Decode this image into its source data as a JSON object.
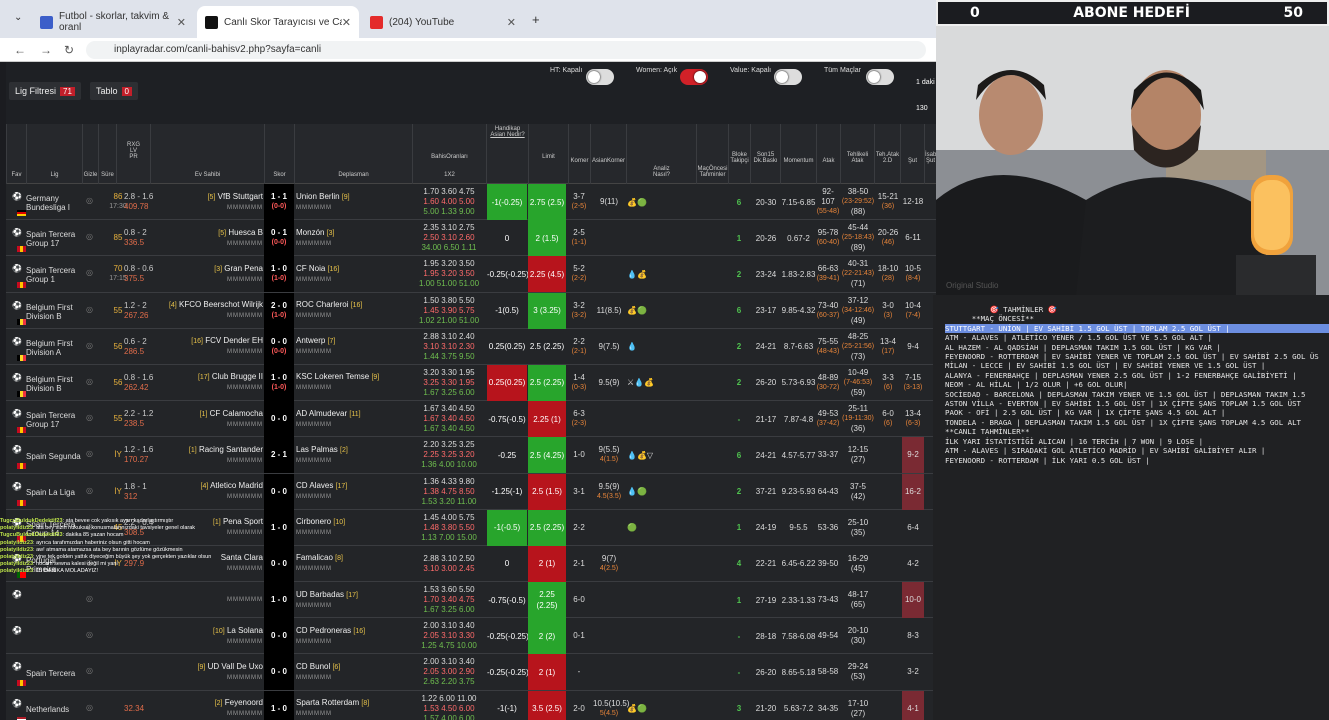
{
  "browser": {
    "tabs": [
      {
        "label": "Futbol - skorlar, takvim & oranl",
        "icon": "flashscore-icon"
      },
      {
        "label": "Canlı Skor Tarayıcısı ve Canlı Sk",
        "icon": "inplayradar-icon"
      },
      {
        "label": "(204) YouTube",
        "icon": "youtube-icon"
      }
    ],
    "url": "inplayradar.com/canli-bahisv2.php?sayfa=canli"
  },
  "filters": {
    "lig": "Lig Filtresi",
    "lig_count": "71",
    "tablo": "Tablo",
    "tablo_count": "0",
    "ht": "HT: Kapalı",
    "women": "Women: Açık",
    "value": "Value: Kapalı",
    "tum": "Tüm Maçlar",
    "side": "1 daki",
    "side2": "130 dak"
  },
  "headers": {
    "fav": "Fav",
    "lig": "Lig",
    "gizle": "Gizle",
    "sure": "Süre",
    "rxg": "RXG",
    "lv": "LV",
    "pr": "PR",
    "ev": "Ev Sahibi",
    "skor": "Skor",
    "dep": "Deplasman",
    "bo": "BahisOranları",
    "x2": "1X2",
    "hcp": "Handikap",
    "asian": "Asian Nedir?",
    "limit": "Limit",
    "korner": "Korner",
    "asian_korner": "AsianKorner",
    "analiz": "Analiz",
    "nasil": "Nasıl?",
    "maconcesi": "MaçÖncesi Tahminler",
    "bloke": "Bloke Takipçi",
    "son15": "Son15 Dk.Baskı",
    "momentum": "Momentum",
    "atak": "Atak",
    "tehlikeli": "Tehlikeli Atak",
    "tehatak": "Teh.Atak 2.D",
    "sut": "Şut",
    "isabet": "İsabet Şut"
  },
  "rows": [
    {
      "lig": "Germany Bundesliga I",
      "flag": "de",
      "min": "86",
      "time": "17:30",
      "rxg": "2.8 - 1.6",
      "r": "409.78",
      "home": "VfB Stuttgart",
      "hr": "[5]",
      "score": "1 - 1",
      "ht": "(0-0)",
      "away": "Union Berlin",
      "ar": "[9]",
      "o1": "1.70  3.60  4.75",
      "o2": "1.60  4.00  5.00",
      "o3": "5.00  1.33  9.00",
      "hcp": "-1(-0.25)",
      "hc": "g",
      "lim": "2.75 (2.5)",
      "lc": "g",
      "kor": "3-7",
      "ks": "(2-5)",
      "ak": "9(11)",
      "aks": "",
      "an": "💰🟢",
      "bk": "6",
      "sn": "20-30",
      "mo": "7.15-6.85",
      "at": "92-107",
      "ats": "(55-48)",
      "te": "38-50",
      "tes": "(23-29:52)",
      "te3": "(88)",
      "ta": "15-21",
      "tas": "(36)",
      "su": "12-18",
      "sus": "",
      "shl": false
    },
    {
      "lig": "Spain Tercera Group 17",
      "flag": "es",
      "min": "85",
      "time": "",
      "rxg": "0.8 - 2",
      "r": "336.5",
      "home": "Huesca B",
      "hr": "[5]",
      "score": "0 - 1",
      "ht": "(0-0)",
      "away": "Monzón",
      "ar": "[3]",
      "o1": "2.35  3.10  2.75",
      "o2": "2.50  3.10  2.60",
      "o3": "34.00  6.50  1.11",
      "hcp": "0",
      "hc": "d",
      "lim": "2 (1.5)",
      "lc": "g",
      "kor": "2-5",
      "ks": "(1-1)",
      "ak": "",
      "aks": "",
      "an": "",
      "bk": "1",
      "sn": "20-26",
      "mo": "0.67-2",
      "at": "95-78",
      "ats": "(60-40)",
      "te": "45-44",
      "tes": "(25-18:43)",
      "te3": "(89)",
      "ta": "20-26",
      "tas": "(46)",
      "su": "6-11",
      "sus": "",
      "shl": false
    },
    {
      "lig": "Spain Tercera Group 1",
      "flag": "es",
      "min": "70",
      "time": "17:15",
      "rxg": "0.8 - 0.6",
      "r": "375.5",
      "home": "Gran Pena",
      "hr": "[3]",
      "score": "1 - 0",
      "ht": "(1-0)",
      "away": "CF Noia",
      "ar": "[16]",
      "o1": "1.95  3.20  3.50",
      "o2": "1.95  3.20  3.50",
      "o3": "1.00  51.00  51.00",
      "hcp": "-0.25(-0.25)",
      "hc": "d",
      "lim": "2.25 (4.5)",
      "lc": "r",
      "kor": "5-2",
      "ks": "(2-2)",
      "ak": "",
      "aks": "",
      "an": "💧💰",
      "bk": "2",
      "sn": "23-24",
      "mo": "1.83-2.83",
      "at": "66-63",
      "ats": "(39-41)",
      "te": "40-31",
      "tes": "(22-21:43)",
      "te3": "(71)",
      "ta": "18-10",
      "tas": "(28)",
      "su": "10-5",
      "sus": "(8-4)",
      "shl": false
    },
    {
      "lig": "Belgium First Division B",
      "flag": "be",
      "min": "55",
      "time": "",
      "rxg": "1.2 - 2",
      "r": "267.26",
      "home": "KFCO Beerschot Wilrijk",
      "hr": "[4]",
      "score": "2 - 0",
      "ht": "(1-0)",
      "away": "ROC Charleroi",
      "ar": "[16]",
      "o1": "1.50  3.80  5.50",
      "o2": "1.45  3.90  5.75",
      "o3": "1.02  21.00  51.00",
      "hcp": "-1(0.5)",
      "hc": "d",
      "lim": "3 (3.25)",
      "lc": "g",
      "kor": "3-2",
      "ks": "(3-2)",
      "ak": "11(8.5)",
      "aks": "",
      "an": "💰🟢",
      "bk": "6",
      "sn": "23-17",
      "mo": "9.85-4.32",
      "at": "73-40",
      "ats": "(60-37)",
      "te": "37-12",
      "tes": "(34-12:46)",
      "te3": "(49)",
      "ta": "3-0",
      "tas": "(3)",
      "su": "10-4",
      "sus": "(7-4)",
      "shl": false
    },
    {
      "lig": "Belgium First Division A",
      "flag": "be",
      "min": "56",
      "time": "",
      "rxg": "0.6 - 2",
      "r": "286.5",
      "home": "FCV Dender EH",
      "hr": "[16]",
      "score": "0 - 0",
      "ht": "(0-0)",
      "away": "Antwerp",
      "ar": "[7]",
      "o1": "2.88  3.10  2.40",
      "o2": "3.10  3.10  2.30",
      "o3": "1.44  3.75  9.50",
      "hcp": "0.25(0.25)",
      "hc": "d",
      "lim": "2.5 (2.25)",
      "lc": "d",
      "kor": "2-2",
      "ks": "(2-1)",
      "ak": "9(7.5)",
      "aks": "",
      "an": "💧",
      "bk": "2",
      "sn": "24-21",
      "mo": "8.7-6.63",
      "at": "75-55",
      "ats": "(48-43)",
      "te": "48-25",
      "tes": "(25-21:56)",
      "te3": "(73)",
      "ta": "13-4",
      "tas": "(17)",
      "su": "9-4",
      "sus": "",
      "shl": false
    },
    {
      "lig": "Belgium First Division B",
      "flag": "be",
      "min": "56",
      "time": "",
      "rxg": "0.8 - 1.6",
      "r": "262.42",
      "home": "Club Brugge II",
      "hr": "[17]",
      "score": "1 - 0",
      "ht": "(1-0)",
      "away": "KSC Lokeren Temse",
      "ar": "[9]",
      "o1": "3.20  3.30  1.95",
      "o2": "3.25  3.30  1.95",
      "o3": "1.67  3.25  6.00",
      "hcp": "0.25(0.25)",
      "hc": "r",
      "lim": "2.5 (2.25)",
      "lc": "g",
      "kor": "1-4",
      "ks": "(0-3)",
      "ak": "9.5(9)",
      "aks": "",
      "an": "⚔💧💰",
      "bk": "2",
      "sn": "26-20",
      "mo": "5.73-6.93",
      "at": "48-89",
      "ats": "(30-72)",
      "te": "10-49",
      "tes": "(7-46:53)",
      "te3": "(59)",
      "ta": "3-3",
      "tas": "(6)",
      "su": "7-15",
      "sus": "(3-13)",
      "shl": false
    },
    {
      "lig": "Spain Tercera Group 17",
      "flag": "es",
      "min": "55",
      "time": "",
      "rxg": "2.2 - 1.2",
      "r": "238.5",
      "home": "CF Calamocha",
      "hr": "[1]",
      "score": "0 - 0",
      "ht": "",
      "away": "AD Almudevar",
      "ar": "[11]",
      "o1": "1.67  3.40  4.50",
      "o2": "1.67  3.40  4.50",
      "o3": "1.67  3.40  4.50",
      "hcp": "-0.75(-0.5)",
      "hc": "d",
      "lim": "2.25 (1)",
      "lc": "r",
      "kor": "6-3",
      "ks": "(2-3)",
      "ak": "",
      "aks": "",
      "an": "",
      "bk": "-",
      "sn": "21-17",
      "mo": "7.87-4.8",
      "at": "49-53",
      "ats": "(37-42)",
      "te": "25-11",
      "tes": "(19-11:30)",
      "te3": "(36)",
      "ta": "6-0",
      "tas": "(6)",
      "su": "13-4",
      "sus": "(6-3)",
      "shl": false
    },
    {
      "lig": "Spain Segunda",
      "flag": "es",
      "min": "İY",
      "time": "",
      "rxg": "1.2 - 1.6",
      "r": "170.27",
      "home": "Racing Santander",
      "hr": "[1]",
      "score": "2 - 1",
      "ht": "",
      "away": "Las Palmas",
      "ar": "[2]",
      "o1": "2.20  3.25  3.25",
      "o2": "2.25  3.25  3.20",
      "o3": "1.36  4.00  10.00",
      "hcp": "-0.25",
      "hc": "d",
      "lim": "2.5 (4.25)",
      "lc": "g",
      "kor": "1-0",
      "ks": "",
      "ak": "9(5.5)",
      "aks": "4(1.5)",
      "an": "💧💰▽",
      "bk": "6",
      "sn": "24-21",
      "mo": "4.57-5.77",
      "at": "33-37",
      "ats": "",
      "te": "12-15",
      "tes": "",
      "te3": "(27)",
      "ta": "",
      "tas": "",
      "su": "9-2",
      "sus": "",
      "shl": true
    },
    {
      "lig": "Spain La Liga",
      "flag": "es",
      "min": "İY",
      "time": "",
      "rxg": "1.8 - 1",
      "r": "312",
      "home": "Atletico Madrid",
      "hr": "[4]",
      "score": "0 - 0",
      "ht": "",
      "away": "CD Alaves",
      "ar": "[17]",
      "o1": "1.36  4.33  9.80",
      "o2": "1.38  4.75  8.50",
      "o3": "1.53  3.20  11.00",
      "hcp": "-1.25(-1)",
      "hc": "d",
      "lim": "2.5 (1.5)",
      "lc": "r",
      "kor": "3-1",
      "ks": "",
      "ak": "9.5(9)",
      "aks": "4.5(3.5)",
      "an": "💧🟢",
      "bk": "2",
      "sn": "37-21",
      "mo": "9.23-5.93",
      "at": "64-43",
      "ats": "",
      "te": "37-5",
      "tes": "",
      "te3": "(42)",
      "ta": "",
      "tas": "",
      "su": "16-2",
      "sus": "",
      "shl": true
    },
    {
      "lig": "Spain Tercera Group 14",
      "flag": "es",
      "min": "45",
      "time": "",
      "rxg": "2.2 - 0.4",
      "r": "308.5",
      "home": "Pena Sport",
      "hr": "[1]",
      "score": "1 - 0",
      "ht": "",
      "away": "Cirbonero",
      "ar": "[10]",
      "o1": "1.45  4.00  5.75",
      "o2": "1.48  3.80  5.50",
      "o3": "1.13  7.00  15.00",
      "hcp": "-1(-0.5)",
      "hc": "g",
      "lim": "2.5 (2.25)",
      "lc": "g",
      "kor": "2-2",
      "ks": "",
      "ak": "",
      "aks": "",
      "an": "🟢",
      "bk": "1",
      "sn": "24-19",
      "mo": "9-5.5",
      "at": "53-36",
      "ats": "",
      "te": "25-10",
      "tes": "",
      "te3": "(35)",
      "ta": "",
      "tas": "",
      "su": "6-4",
      "sus": "",
      "shl": false
    },
    {
      "lig": "Portugal Primeira",
      "flag": "pt",
      "min": "İY",
      "time": "",
      "rxg": "",
      "r": "297.9",
      "home": "Santa Clara",
      "hr": "",
      "score": "0 - 0",
      "ht": "",
      "away": "Famalicao",
      "ar": "[8]",
      "o1": "2.88  3.10  2.50",
      "o2": "3.10  3.00  2.45",
      "o3": "",
      "hcp": "0",
      "hc": "d",
      "lim": "2 (1)",
      "lc": "r",
      "kor": "2-1",
      "ks": "",
      "ak": "9(7)",
      "aks": "4(2.5)",
      "an": "",
      "bk": "4",
      "sn": "22-21",
      "mo": "6.45-6.22",
      "at": "39-50",
      "ats": "",
      "te": "16-29",
      "tes": "",
      "te3": "(45)",
      "ta": "",
      "tas": "",
      "su": "4-2",
      "sus": "",
      "shl": false
    },
    {
      "lig": "",
      "flag": "",
      "min": "",
      "time": "",
      "rxg": "",
      "r": "",
      "home": "",
      "hr": "",
      "score": "1 - 0",
      "ht": "",
      "away": "UD Barbadas",
      "ar": "[17]",
      "o1": "1.53  3.60  5.50",
      "o2": "1.70  3.40  4.75",
      "o3": "1.67  3.25  6.00",
      "hcp": "-0.75(-0.5)",
      "hc": "d",
      "lim": "2.25 (2.25)",
      "lc": "g",
      "kor": "6-0",
      "ks": "",
      "ak": "",
      "aks": "",
      "an": "",
      "bk": "1",
      "sn": "27-19",
      "mo": "2.33-1.33",
      "at": "73-43",
      "ats": "",
      "te": "48-17",
      "tes": "",
      "te3": "(65)",
      "ta": "",
      "tas": "",
      "su": "10-0",
      "sus": "",
      "shl": true
    },
    {
      "lig": "",
      "flag": "",
      "min": "",
      "time": "",
      "rxg": "",
      "r": "",
      "home": "La Solana",
      "hr": "[10]",
      "score": "0 - 0",
      "ht": "",
      "away": "CD Pedroneras",
      "ar": "[16]",
      "o1": "2.00  3.10  3.40",
      "o2": "2.05  3.10  3.30",
      "o3": "1.25  4.75  10.00",
      "hcp": "-0.25(-0.25)",
      "hc": "d",
      "lim": "2 (2)",
      "lc": "g",
      "kor": "0-1",
      "ks": "",
      "ak": "",
      "aks": "",
      "an": "",
      "bk": "-",
      "sn": "28-18",
      "mo": "7.58-6.08",
      "at": "49-54",
      "ats": "",
      "te": "20-10",
      "tes": "",
      "te3": "(30)",
      "ta": "",
      "tas": "",
      "su": "8-3",
      "sus": "",
      "shl": false
    },
    {
      "lig": "Spain Tercera",
      "flag": "es",
      "min": "",
      "time": "",
      "rxg": "",
      "r": "",
      "home": "UD Vall De Uxo",
      "hr": "[9]",
      "score": "0 - 0",
      "ht": "",
      "away": "CD Bunol",
      "ar": "[6]",
      "o1": "2.00  3.10  3.40",
      "o2": "2.05  3.00  2.90",
      "o3": "2.63  2.20  3.75",
      "hcp": "-0.25(-0.25)",
      "hc": "d",
      "lim": "2 (1)",
      "lc": "r",
      "kor": "-",
      "ks": "",
      "ak": "",
      "aks": "",
      "an": "",
      "bk": "-",
      "sn": "26-20",
      "mo": "8.65-5.18",
      "at": "58-58",
      "ats": "",
      "te": "29-24",
      "tes": "",
      "te3": "(53)",
      "ta": "",
      "tas": "",
      "su": "3-2",
      "sus": "",
      "shl": false
    },
    {
      "lig": "Netherlands",
      "flag": "nl",
      "min": "",
      "time": "",
      "rxg": "",
      "r": "32.34",
      "home": "Feyenoord",
      "hr": "[2]",
      "score": "1 - 0",
      "ht": "",
      "away": "Sparta Rotterdam",
      "ar": "[8]",
      "o1": "1.22  6.00  11.00",
      "o2": "1.53  4.50  6.00",
      "o3": "1.57  4.00  6.00",
      "hcp": "-1(-1)",
      "hc": "d",
      "lim": "3.5 (2.5)",
      "lc": "r",
      "kor": "2-0",
      "ks": "",
      "ak": "10.5(10.5)",
      "aks": "5(4.5)",
      "an": "💰🟢",
      "bk": "3",
      "sn": "21-20",
      "mo": "5.63-7.2",
      "at": "34-35",
      "ats": "",
      "te": "17-10",
      "tes": "",
      "te3": "(27)",
      "ta": "",
      "tas": "",
      "su": "4-1",
      "sus": "",
      "shl": true
    }
  ],
  "cam": {
    "abone_left": "0",
    "abone_title": "ABONE HEDEFİ",
    "abone_right": "50"
  },
  "notes": {
    "lines": [
      "          🎯 TAHMİNLER 🎯",
      "      **MAÇ ÖNCESİ**",
      "STUTTGART - UNİON | EV SAHİBİ 1.5 GOL ÜST | TOPLAM 2.5 GOL ÜST |",
      "ATM - ALAVES | ATLETİCO YENER / 1.5 GOL ÜST VE 5.5 GOL ALT |",
      "AL HAZEM - AL QADSİAH | DEPLASMAN TAKIM 1.5 GOL ÜST | KG VAR |",
      "FEYENOORD - ROTTERDAM | EV SAHİBİ YENER VE TOPLAM 2.5 GOL ÜST | EV SAHİBİ 2.5 GOL ÜS",
      "",
      "MİLAN - LECCE | EV SAHİBİ 1.5 GOL ÜST | EV SAHİBİ YENER VE 1.5 GOL ÜST |",
      "ALANYA - FENERBAHÇE | DEPLASMAN YENER 2.5 GOL ÜST | 1-2 FENERBAHÇE GALİBİYETİ |",
      "NEOM - AL HİLAL | 1/2 OLUR | +6 GOL OLUR|",
      "",
      "SOCİEDAD - BARCELONA | DEPLASMAN TAKIM YENER VE 1.5 GOL ÜST | DEPLASMAN TAKIM 1.5",
      "ASTON VİLLA - EVERTON | EV SAHİBİ 1.5 GOL ÜST | 1X ÇİFTE ŞANS TOPLAM 1.5 GOL ÜST",
      "PAOK - OFİ | 2.5 GOL ÜST | KG VAR | 1X ÇİFTE ŞANS 4.5 GOL ALT |",
      "TONDELA - BRAGA | DEPLASMAN TAKIM 1.5 GOL ÜST | 1X ÇİFTE ŞANS TOPLAM 4.5 GOL ALT",
      "",
      "**CANLI TAHMİNLER**",
      "İLK YARI İSTATİSTİĞİ ALICAN | 16 TERCİH | 7 WON | 9 LOSE |",
      "",
      "ATM - ALAVES | SIRADAKİ GOL ATLETİCO MADRİD | EV SAHİBİ GALİBİYET ALIR |",
      "FEYENOORD - ROTTERDAM | İLK YARI 0.5 GOL ÜST |"
    ]
  },
  "chat": [
    {
      "n": "TugcuBuldukDedektif23",
      "m": "ata bevee cok yakısık ayarı kadarlaştırmıştır"
    },
    {
      "n": "polatyildiz23",
      "m": "ata bey sizin hukuksal konusmalarınızdaki tavsiyeler genel olarak"
    },
    {
      "n": "TugcuBuldukDedektif23",
      "m": "dakika 85 yazan hocam"
    },
    {
      "n": "polatyildiz23",
      "m": "ayrıca tarafımızdan haberiniz olsun gitti hocam"
    },
    {
      "n": "polatyildiz23",
      "m": "aw! atmama atamazsa ata bey barınin gözlüme gözükmesin"
    },
    {
      "n": "polatyildiz23",
      "m": "yine tek golden yattık diyeceğim büyük şey yok gerçekten yazıklar olsun"
    },
    {
      "n": "polatyildiz23",
      "m": "hocam sewna kalesi değil mi yani"
    },
    {
      "n": "polatyildiz23",
      "m": "15 DAKİKA MOLADAYIZ!"
    }
  ]
}
